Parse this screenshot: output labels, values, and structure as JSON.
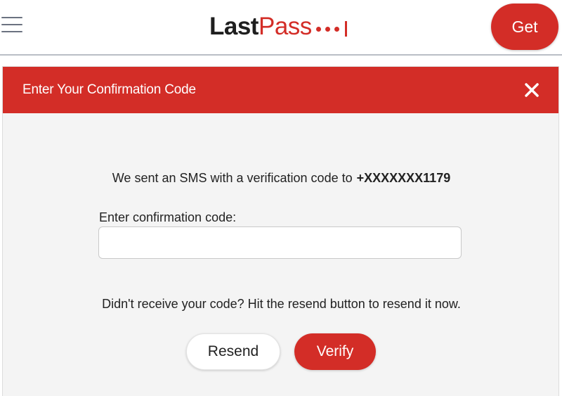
{
  "header": {
    "logo": {
      "part1": "Last",
      "part2": "Pass"
    },
    "get_label": "Get",
    "icons": {
      "menu": "hamburger-menu-icon",
      "logo": "lastpass-logo"
    }
  },
  "dialog": {
    "title": "Enter Your Confirmation Code",
    "close_icon": "close-icon",
    "sms_message": "We sent an SMS with a verification code to",
    "phone_number": "+XXXXXXX1179",
    "code_label": "Enter confirmation code:",
    "code_value": "",
    "code_placeholder": "",
    "resend_message": "Didn't receive your code? Hit the resend button to resend it now.",
    "resend_label": "Resend",
    "verify_label": "Verify"
  },
  "colors": {
    "brand_red": "#d32d27",
    "background": "#ffffff",
    "dialog_bg": "#f4f4f4",
    "text": "#222222"
  }
}
